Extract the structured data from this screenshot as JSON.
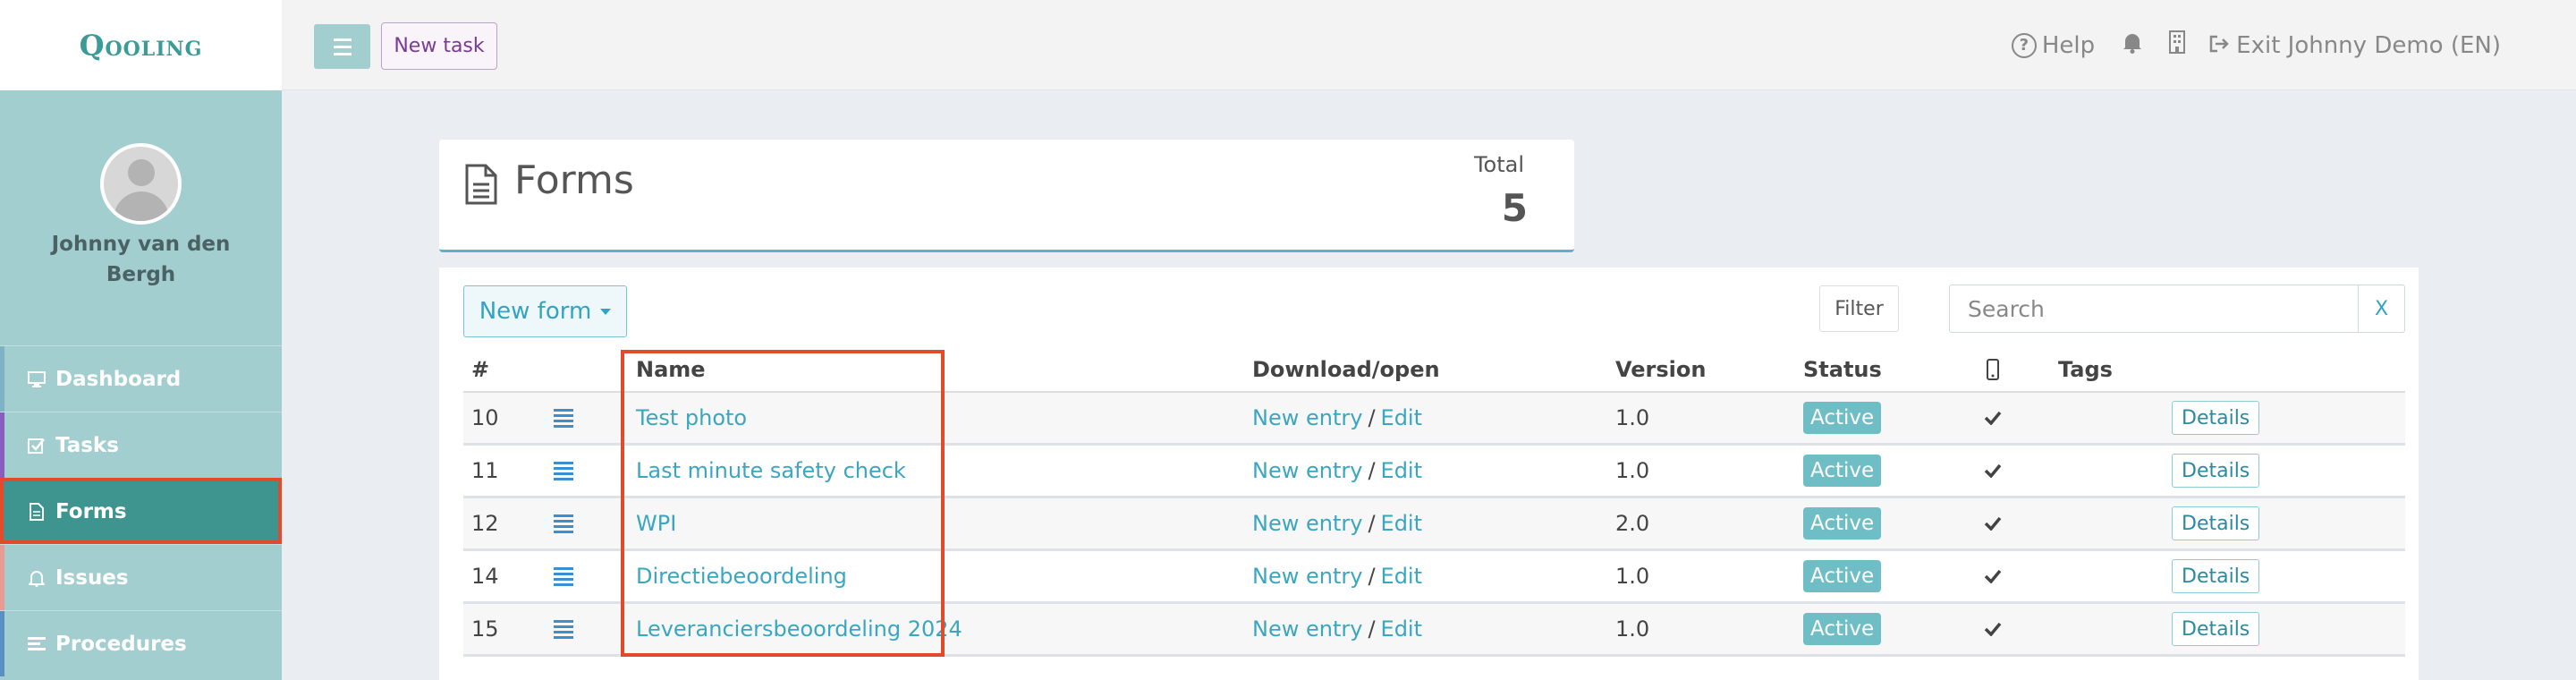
{
  "app": {
    "logo": "Qooling"
  },
  "sidebar": {
    "user_name": "Johnny van den Bergh",
    "items": [
      {
        "label": "Dashboard",
        "icon": "monitor-icon",
        "color": "#7fb2c4"
      },
      {
        "label": "Tasks",
        "icon": "checkbox-icon",
        "color": "#8b5cc0"
      },
      {
        "label": "Forms",
        "icon": "document-icon",
        "color": "#3e9590"
      },
      {
        "label": "Issues",
        "icon": "bell-icon",
        "color": "#e89a95"
      },
      {
        "label": "Procedures",
        "icon": "list-icon",
        "color": "#5a8fc4"
      }
    ]
  },
  "topbar": {
    "new_task_label": "New task",
    "help_label": "Help",
    "exit_label": "Exit Johnny Demo (EN)"
  },
  "header": {
    "title": "Forms",
    "total_label": "Total",
    "total_value": "5"
  },
  "toolbar": {
    "new_form_label": "New form",
    "filter_label": "Filter",
    "search_placeholder": "Search",
    "clear_label": "X"
  },
  "table": {
    "columns": [
      "#",
      "Name",
      "Download/open",
      "Version",
      "Status",
      "Tags"
    ],
    "rows": [
      {
        "id": "10",
        "name": "Test photo",
        "new_entry": "New entry",
        "sep": "/",
        "edit": "Edit",
        "version": "1.0",
        "status": "Active",
        "details": "Details"
      },
      {
        "id": "11",
        "name": "Last minute safety check",
        "new_entry": "New entry",
        "sep": "/",
        "edit": "Edit",
        "version": "1.0",
        "status": "Active",
        "details": "Details"
      },
      {
        "id": "12",
        "name": "WPI",
        "new_entry": "New entry",
        "sep": "/",
        "edit": "Edit",
        "version": "2.0",
        "status": "Active",
        "details": "Details"
      },
      {
        "id": "14",
        "name": "Directiebeoordeling",
        "new_entry": "New entry",
        "sep": "/",
        "edit": "Edit",
        "version": "1.0",
        "status": "Active",
        "details": "Details"
      },
      {
        "id": "15",
        "name": "Leveranciersbeoordeling 2024",
        "new_entry": "New entry",
        "sep": "/",
        "edit": "Edit",
        "version": "1.0",
        "status": "Active",
        "details": "Details"
      }
    ]
  },
  "colors": {
    "accent": "#3aa6c2",
    "sidebar": "#a3ced0",
    "active_nav": "#3e9590",
    "highlight": "#e24a2c"
  }
}
